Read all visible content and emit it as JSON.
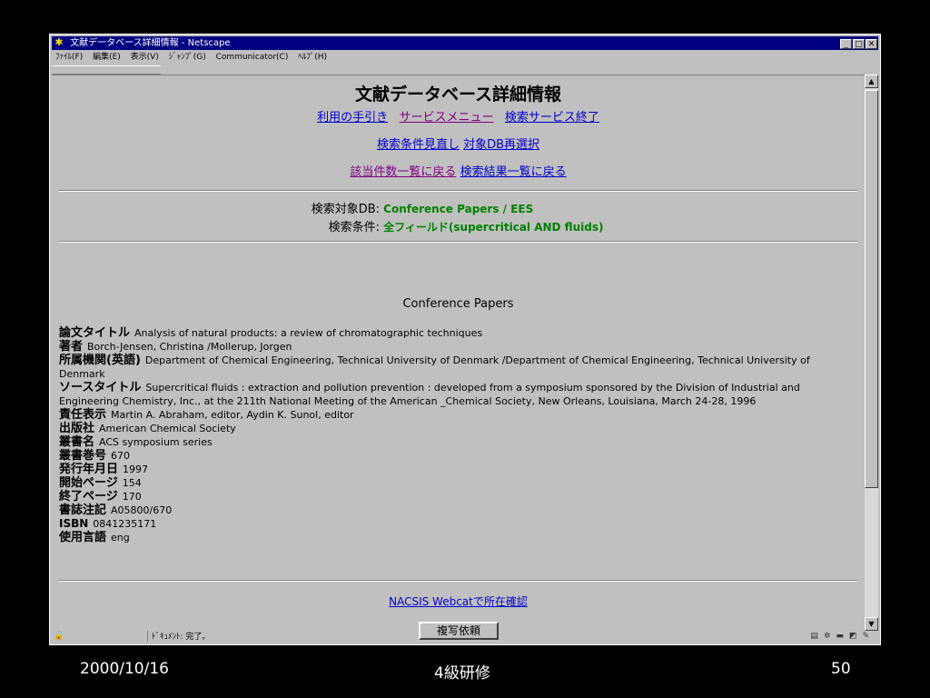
{
  "window": {
    "title": "文献データベース詳細情報 - Netscape",
    "menu": [
      "ﾌｧｲﾙ(F)",
      "編集(E)",
      "表示(V)",
      "ｼﾞｬﾝﾌﾟ(G)",
      "Communicator(C)",
      "ﾍﾙﾌﾟ(H)"
    ]
  },
  "page": {
    "heading": "文献データベース詳細情報",
    "nav1": [
      "利用の手引き",
      "サービスメニュー",
      "検索サービス終了"
    ],
    "nav2": [
      "検索条件見直し",
      "対象DB再選択"
    ],
    "nav3": [
      "該当件数一覧に戻る",
      "検索結果一覧に戻る"
    ],
    "db_label": "検索対象DB:",
    "db_value": "Conference Papers / EES",
    "cond_label": "検索条件:",
    "cond_value": "全フィールド(supercritical AND fluids)",
    "section_title": "Conference Papers",
    "fields": [
      {
        "label": "論文タイトル",
        "value": "Analysis of natural products: a review of chromatographic techniques"
      },
      {
        "label": "著者",
        "value": "Borch-Jensen, Christina /Mollerup, Jorgen"
      },
      {
        "label": "所属機関(英語)",
        "value": "Department of Chemical Engineering, Technical University of Denmark /Department of Chemical Engineering, Technical University of Denmark"
      },
      {
        "label": "ソースタイトル",
        "value": "Supercritical fluids : extraction and pollution prevention : developed from a symposium sponsored by the Division of Industrial and Engineering Chemistry, Inc., at the 211th National Meeting of the American _Chemical Society, New Orleans, Louisiana, March 24-28, 1996"
      },
      {
        "label": "責任表示",
        "value": "Martin A. Abraham, editor, Aydin K. Sunol, editor"
      },
      {
        "label": "出版社",
        "value": "American Chemical Society"
      },
      {
        "label": "叢書名",
        "value": "ACS symposium series"
      },
      {
        "label": "叢書巻号",
        "value": "670"
      },
      {
        "label": "発行年月日",
        "value": "1997"
      },
      {
        "label": "開始ページ",
        "value": "154"
      },
      {
        "label": "終了ページ",
        "value": "170"
      },
      {
        "label": "書誌注記",
        "value": "A05800/670"
      },
      {
        "label": "ISBN",
        "value": "0841235171"
      },
      {
        "label": "使用言語",
        "value": "eng"
      }
    ],
    "webcat_link": "NACSIS Webcatで所在確認",
    "copy_button": "複写依頼"
  },
  "status": {
    "text": "ﾄﾞｷｭﾒﾝﾄ: 完了。"
  },
  "footer": {
    "date": "2000/10/16",
    "center": "4級研修",
    "page": "50"
  },
  "colors": {
    "link": "#0000cc",
    "visited": "#800080",
    "query_value": "#008000",
    "titlebar": "#000080"
  }
}
